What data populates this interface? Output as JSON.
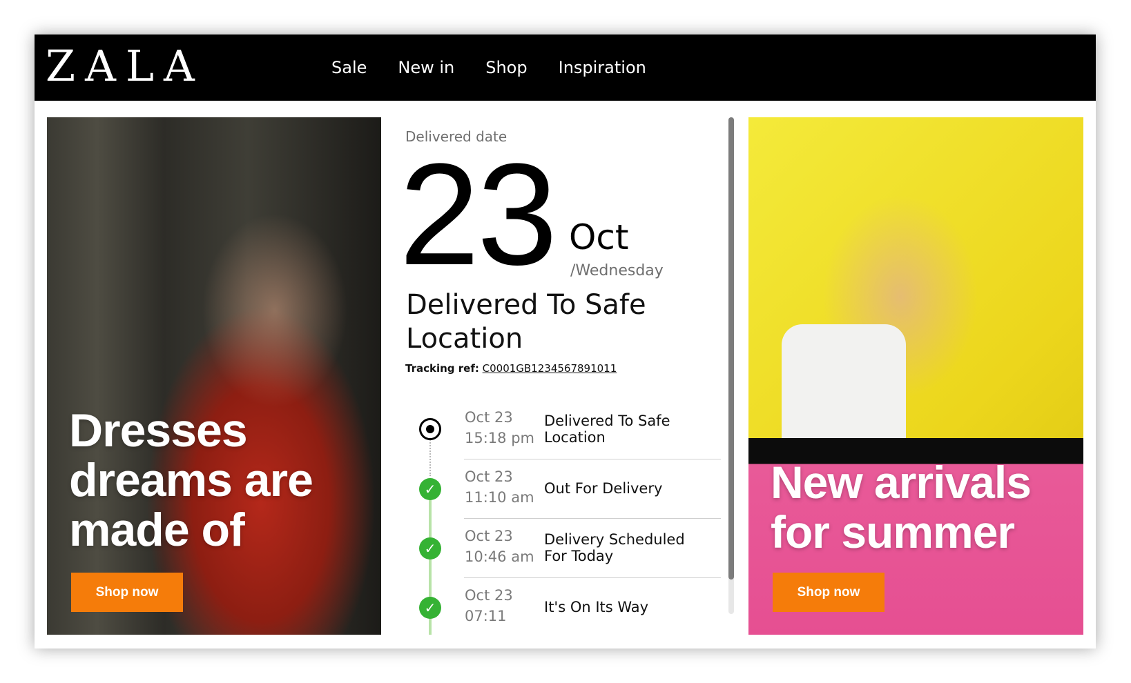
{
  "brand": {
    "logo": "ZALA"
  },
  "nav": {
    "items": [
      "Sale",
      "New in",
      "Shop",
      "Inspiration"
    ]
  },
  "promo_left": {
    "heading": "Dresses dreams are made of",
    "button": "Shop now",
    "image": "woman in red satin dress"
  },
  "promo_right": {
    "heading": "New arrivals for summer",
    "button": "Shop now",
    "image": "woman in white top and pink skirt with palm leaves"
  },
  "delivery": {
    "label": "Delivered date",
    "day": "23",
    "month": "Oct",
    "weekday": "/Wednesday",
    "status": "Delivered To Safe Location",
    "tracking_label": "Tracking ref:",
    "tracking_ref": "C0001GB1234567891011"
  },
  "timeline": [
    {
      "date": "Oct 23",
      "time": "15:18 pm",
      "desc": "Delivered To Safe Location",
      "state": "current"
    },
    {
      "date": "Oct 23",
      "time": "11:10 am",
      "desc": "Out For Delivery",
      "state": "done"
    },
    {
      "date": "Oct 23",
      "time": "10:46 am",
      "desc": "Delivery Scheduled For Today",
      "state": "done"
    },
    {
      "date": "Oct 23",
      "time": "07:11",
      "desc": "It's On Its Way",
      "state": "done"
    }
  ],
  "colors": {
    "brand_bg": "#000000",
    "accent": "#f57c0a",
    "done": "#35b234"
  },
  "icons": {
    "current": "radio-current-icon",
    "done": "check-circle-icon"
  }
}
